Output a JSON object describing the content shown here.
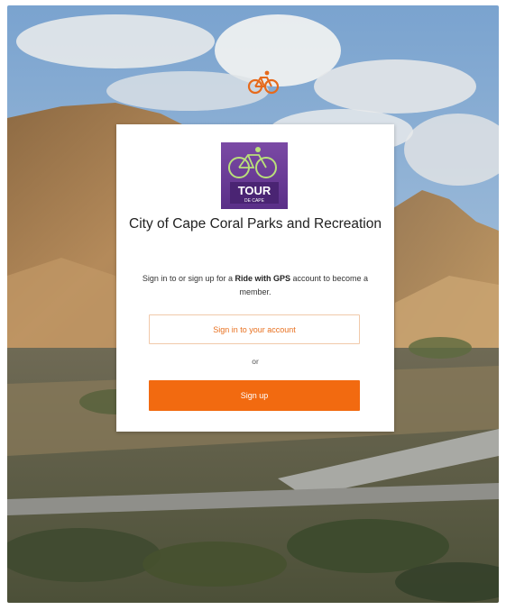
{
  "page": {
    "brand_icon": "cyclist-icon",
    "accent_color": "#f26a10"
  },
  "card": {
    "logo": {
      "icon": "tour-de-cape-logo",
      "line1": "TOUR",
      "line2": "DE CAPE"
    },
    "org_name": "City of Cape Coral Parks and Recreation",
    "intro_prefix": "Sign in to or sign up for a ",
    "intro_bold": "Ride with GPS",
    "intro_suffix": " account to become a member.",
    "signin_label": "Sign in to your account",
    "or_label": "or",
    "signup_label": "Sign up"
  }
}
